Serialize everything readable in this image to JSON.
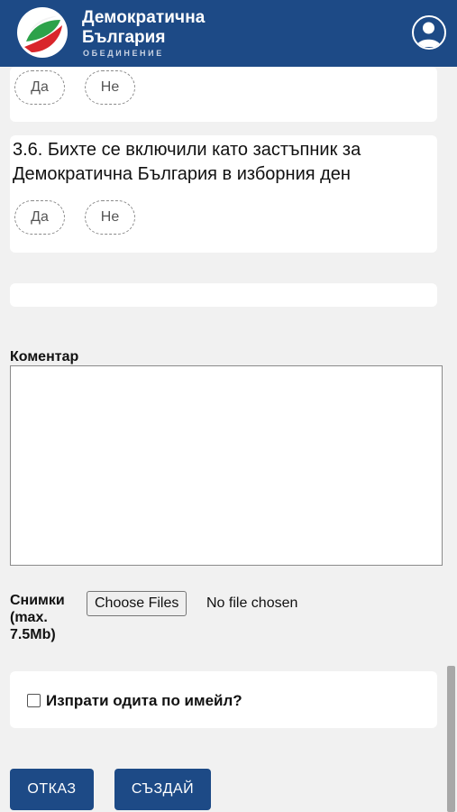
{
  "header": {
    "brand_line1": "Демократична",
    "brand_line2": "България",
    "brand_line3": "ОБЕДИНЕНИЕ",
    "logo_icon": "party-logo-icon",
    "user_icon": "user-avatar-icon",
    "color": "#1d4a86"
  },
  "previous_question": {
    "yes_label": "Да",
    "no_label": "Не"
  },
  "question_3_6": {
    "text": "3.6. Бихте се включили като застъпник за Демократична България в изборния ден",
    "yes_label": "Да",
    "no_label": "Не"
  },
  "comment": {
    "label": "Коментар",
    "value": ""
  },
  "photos": {
    "label": "Снимки (max. 7.5Mb)",
    "button_label": "Choose Files",
    "status": "No file chosen"
  },
  "send_email": {
    "label": "Изпрати одита по имейл?",
    "checked": false
  },
  "actions": {
    "cancel_label": "ОТКАЗ",
    "create_label": "СЪЗДАЙ"
  }
}
